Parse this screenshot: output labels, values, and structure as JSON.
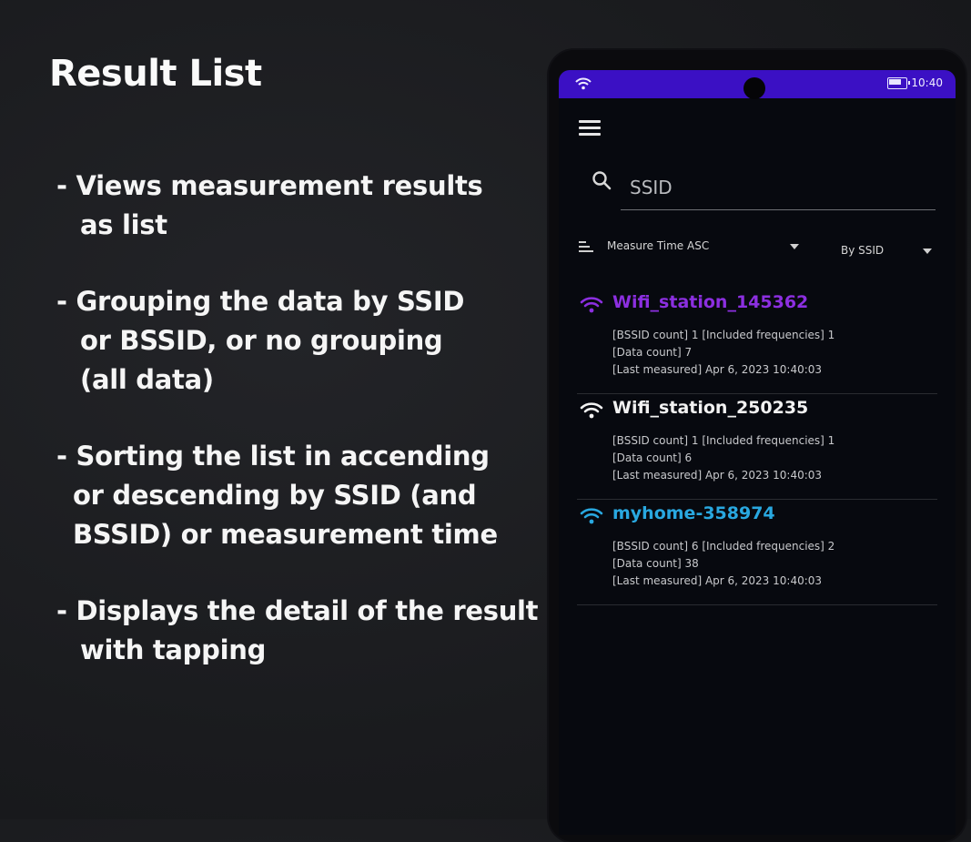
{
  "promo": {
    "title": "Result List",
    "bullets": [
      [
        "- Views measurement results",
        "as list"
      ],
      [
        "- Grouping the data by SSID",
        "or BSSID, or no grouping",
        "(all data)"
      ],
      [
        "- Sorting the list in accending",
        "or descending by SSID (and",
        "BSSID) or measurement time"
      ],
      [
        "- Displays the detail of the result",
        "with tapping"
      ]
    ]
  },
  "status_bar": {
    "time": "10:40",
    "color": "#3b10c4"
  },
  "search": {
    "placeholder": "SSID"
  },
  "sort": {
    "selected": "Measure Time ASC"
  },
  "grouping": {
    "selected": "By SSID"
  },
  "results": [
    {
      "ssid": "Wifi_station_145362",
      "color": "#8c2fe0",
      "details": [
        "[BSSID count] 1 [Included frequencies] 1",
        "[Data count] 7",
        "[Last measured] Apr 6, 2023 10:40:03"
      ]
    },
    {
      "ssid": "Wifi_station_250235",
      "color": "#f2f2f2",
      "details": [
        "[BSSID count] 1 [Included frequencies] 1",
        "[Data count] 6",
        "[Last measured] Apr 6, 2023 10:40:03"
      ]
    },
    {
      "ssid": "myhome-358974",
      "color": "#29a8e0",
      "details": [
        "[BSSID count] 6 [Included frequencies] 2",
        "[Data count] 38",
        "[Last measured] Apr 6, 2023 10:40:03"
      ]
    }
  ],
  "icons": {
    "status": [
      "wifi-icon",
      "battery-icon"
    ],
    "toolbar": [
      "menu-icon",
      "search-icon",
      "sort-icon",
      "chevron-down-icon"
    ],
    "list": [
      "wifi-icon"
    ]
  }
}
